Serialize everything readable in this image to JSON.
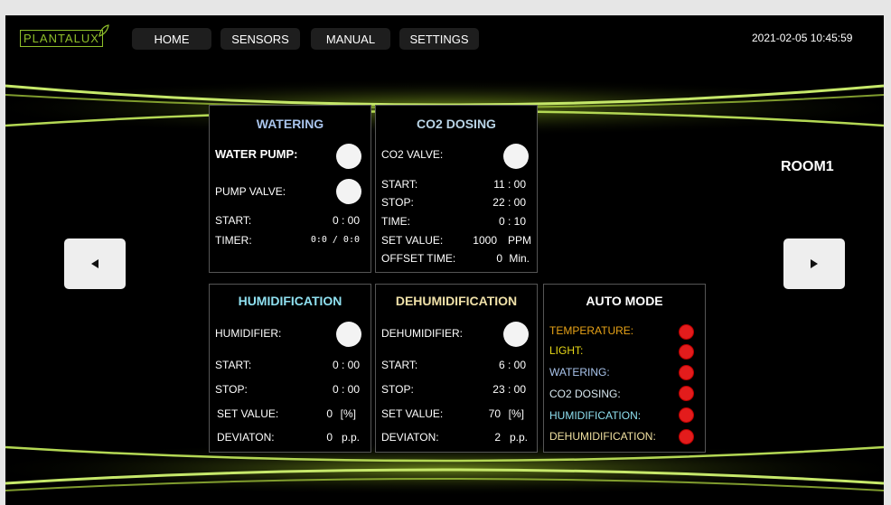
{
  "header": {
    "logo": "PLANTALUX",
    "nav": [
      "HOME",
      "SENSORS",
      "MANUAL",
      "SETTINGS"
    ],
    "datetime": "2021-02-05  10:45:59"
  },
  "room": "ROOM1",
  "watering": {
    "title": "WATERING",
    "water_pump": "WATER PUMP:",
    "pump_valve": "PUMP VALVE:",
    "start_label": "START:",
    "start_value": "0  :  00",
    "timer_label": "TIMER:",
    "timer_value": "0:0   /   0:0"
  },
  "co2": {
    "title": "CO2 DOSING",
    "valve": "CO2 VALVE:",
    "start_label": "START:",
    "start_value": "11  : 00",
    "stop_label": "STOP:",
    "stop_value": "22  : 00",
    "time_label": "TIME:",
    "time_value": "0  : 10",
    "set_label": "SET VALUE:",
    "set_value": "1000",
    "set_unit": "PPM",
    "offset_label": "OFFSET TIME:",
    "offset_value": "0",
    "offset_unit": "Min."
  },
  "humidification": {
    "title": "HUMIDIFICATION",
    "device": "HUMIDIFIER:",
    "start_label": "START:",
    "start_value": "0  : 00",
    "stop_label": "STOP:",
    "stop_value": "0  : 00",
    "set_label": "SET VALUE:",
    "set_value": "0",
    "set_unit": "[%]",
    "dev_label": "DEVIATON:",
    "dev_value": "0",
    "dev_unit": "p.p."
  },
  "dehumidification": {
    "title": "DEHUMIDIFICATION",
    "device": "DEHUMIDIFIER:",
    "start_label": "START:",
    "start_value": "6  : 00",
    "stop_label": "STOP:",
    "stop_value": "23  : 00",
    "set_label": "SET VALUE:",
    "set_value": "70",
    "set_unit": "[%]",
    "dev_label": "DEVIATON:",
    "dev_value": "2",
    "dev_unit": "p.p."
  },
  "auto_mode": {
    "title": "AUTO MODE",
    "items": [
      {
        "label": "TEMPERATURE:",
        "color": "#e8a317"
      },
      {
        "label": "LIGHT:",
        "color": "#e8d817"
      },
      {
        "label": "WATERING:",
        "color": "#a9c4ec"
      },
      {
        "label": "CO2 DOSING:",
        "color": "#d8e8f0"
      },
      {
        "label": "HUMIDIFICATION:",
        "color": "#8fe0f0"
      },
      {
        "label": "DEHUMIDIFICATION:",
        "color": "#f0e0a0"
      }
    ],
    "status_color": "#e31c1c"
  },
  "colors": {
    "watering_title": "#a9c4ec",
    "co2_title": "#b9d4e6",
    "humid_title": "#8fe0f0",
    "dehumid_title": "#efe0a8",
    "glow": "#8fbf2a"
  }
}
